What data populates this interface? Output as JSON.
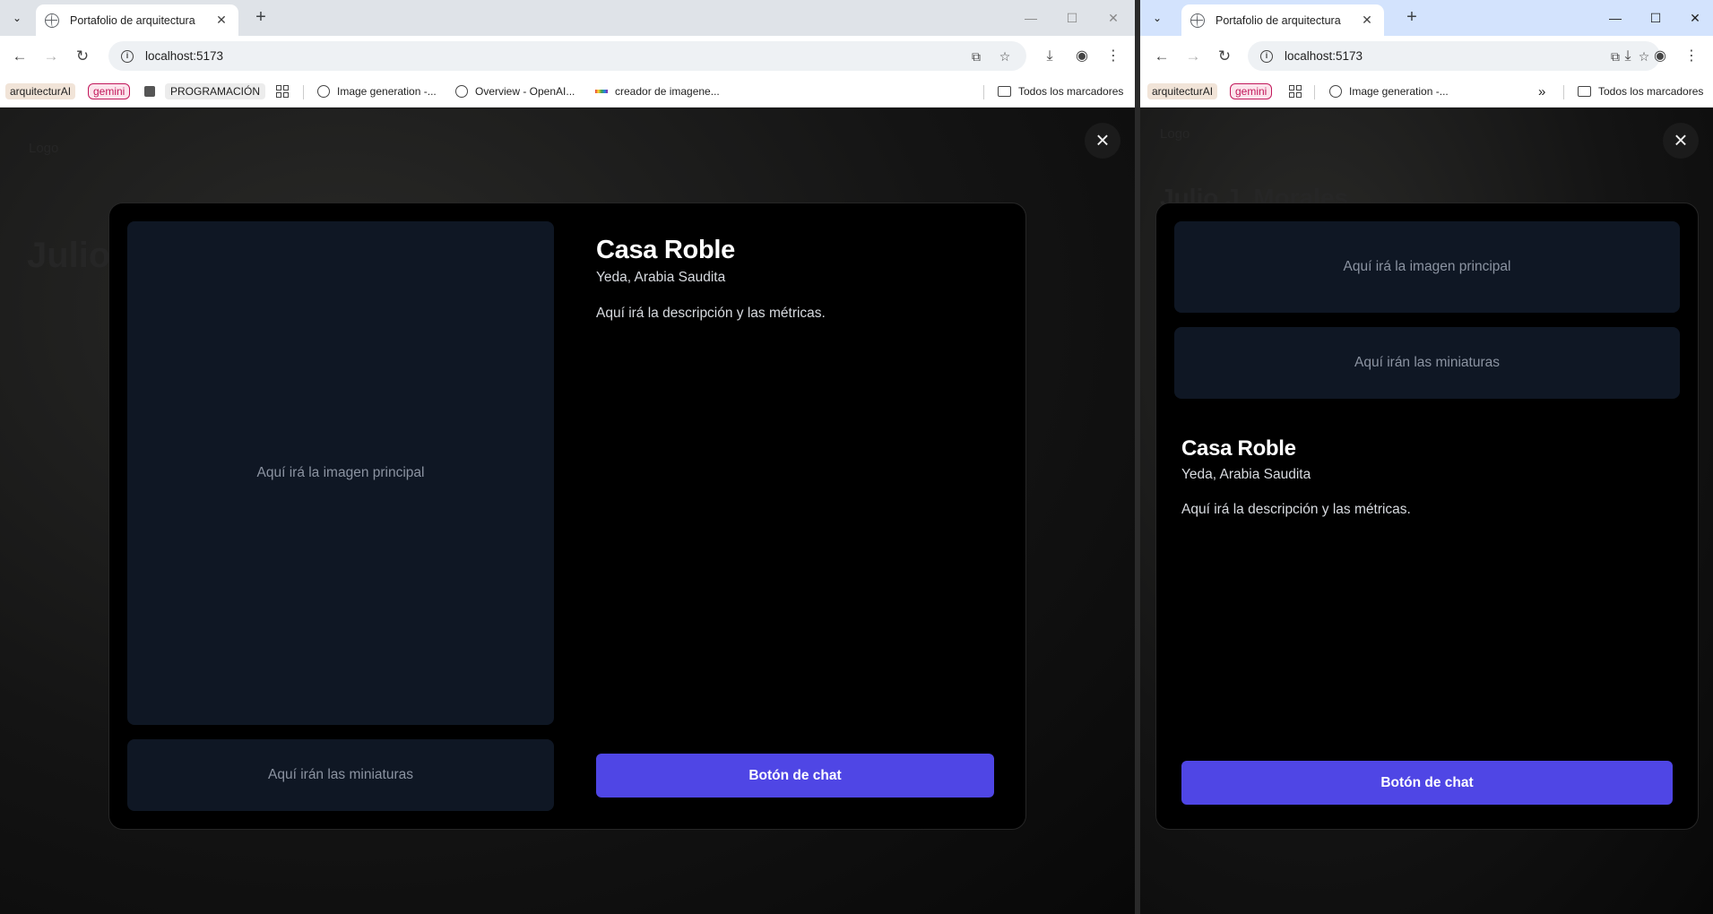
{
  "browser": {
    "tab_title": "Portafolio de arquitectura",
    "url": "localhost:5173",
    "bookmarks_left": {
      "arquitectura": "arquitecturAI",
      "gemini": "gemini",
      "programacion": "PROGRAMACIÓN",
      "image_generation": "Image generation -...",
      "overview": "Overview - OpenAI...",
      "creador": "creador de imagene...",
      "all_bookmarks": "Todos los marcadores"
    },
    "bookmarks_right": {
      "arquitectura": "arquitecturAI",
      "gemini": "gemini",
      "image_generation": "Image generation -...",
      "overflow": "»",
      "all_bookmarks": "Todos los marcadores"
    }
  },
  "background": {
    "logo_text": "Logo",
    "name_partial_left": "Julio",
    "name_partial_right": "Julio J. Morales"
  },
  "modal": {
    "close_label": "×",
    "main_image_placeholder": "Aquí irá la imagen principal",
    "thumbnails_placeholder": "Aquí irán las miniaturas",
    "project_title": "Casa Roble",
    "project_location": "Yeda, Arabia Saudita",
    "project_description": "Aquí irá la descripción y las métricas.",
    "chat_button": "Botón de chat"
  },
  "colors": {
    "accent": "#4f46e5",
    "placeholder_bg": "#0f1724",
    "modal_bg": "#000000"
  }
}
